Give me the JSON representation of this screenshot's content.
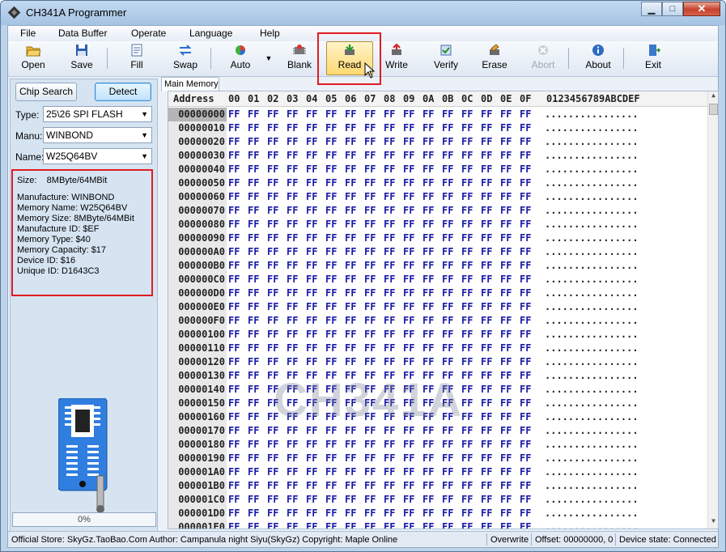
{
  "window": {
    "title": "CH341A Programmer"
  },
  "menu": [
    "File",
    "Data Buffer",
    "Operate",
    "Language",
    "Help"
  ],
  "toolbar": [
    {
      "label": "Open",
      "icon": "folder-open-icon"
    },
    {
      "label": "Save",
      "icon": "floppy-save-icon"
    },
    {
      "label": "Fill",
      "icon": "fill-icon"
    },
    {
      "label": "Swap",
      "icon": "swap-arrows-icon"
    },
    {
      "label": "Auto",
      "icon": "auto-icon"
    },
    {
      "label": "Blank",
      "icon": "blank-check-icon"
    },
    {
      "label": "Read",
      "icon": "chip-read-icon"
    },
    {
      "label": "Write",
      "icon": "chip-write-icon"
    },
    {
      "label": "Verify",
      "icon": "verify-icon"
    },
    {
      "label": "Erase",
      "icon": "erase-icon"
    },
    {
      "label": "Abort",
      "icon": "abort-icon"
    },
    {
      "label": "About",
      "icon": "info-icon"
    },
    {
      "label": "Exit",
      "icon": "exit-door-icon"
    }
  ],
  "chip": {
    "search_label": "Chip Search",
    "detect_label": "Detect",
    "type_label": "Type:",
    "type_value": "25\\26 SPI FLASH",
    "manu_label": "Manu:",
    "manu_value": "WINBOND",
    "name_label": "Name:",
    "name_value": "W25Q64BV"
  },
  "info": {
    "size": "Size:    8MByte/64MBit",
    "lines": [
      "Manufacture: WINBOND",
      "Memory Name: W25Q64BV",
      "Memory Size: 8MByte/64MBit",
      "Manufacture ID: $EF",
      "Memory Type: $40",
      "Memory Capacity: $17",
      "Device ID: $16",
      "Unique ID: D1643C3"
    ]
  },
  "progress": {
    "text": "0%",
    "value": 0
  },
  "tab": {
    "label": "Main Memory"
  },
  "hex": {
    "header_address": "Address",
    "header_cols": [
      "00",
      "01",
      "02",
      "03",
      "04",
      "05",
      "06",
      "07",
      "08",
      "09",
      "0A",
      "0B",
      "0C",
      "0D",
      "0E",
      "0F"
    ],
    "header_ascii": "0123456789ABCDEF",
    "addresses": [
      "00000000",
      "00000010",
      "00000020",
      "00000030",
      "00000040",
      "00000050",
      "00000060",
      "00000070",
      "00000080",
      "00000090",
      "000000A0",
      "000000B0",
      "000000C0",
      "000000D0",
      "000000E0",
      "000000F0",
      "00000100",
      "00000110",
      "00000120",
      "00000130",
      "00000140",
      "00000150",
      "00000160",
      "00000170",
      "00000180",
      "00000190",
      "000001A0",
      "000001B0",
      "000001C0",
      "000001D0",
      "000001E0"
    ],
    "byte_value": "FF",
    "ascii_value": "................",
    "watermark": "CH341A"
  },
  "status": {
    "store": "Official Store: SkyGz.TaoBao.Com Author: Campanula night Siyu(SkyGz) Copyright: Maple Online",
    "mode": "Overwrite",
    "offset": "Offset: 00000000, 0",
    "device": "Device state: Connected"
  },
  "colors": {
    "accent_red": "#e01b22",
    "hex_blue": "#1a1aa6",
    "title_blue": "#a5c3e3"
  }
}
